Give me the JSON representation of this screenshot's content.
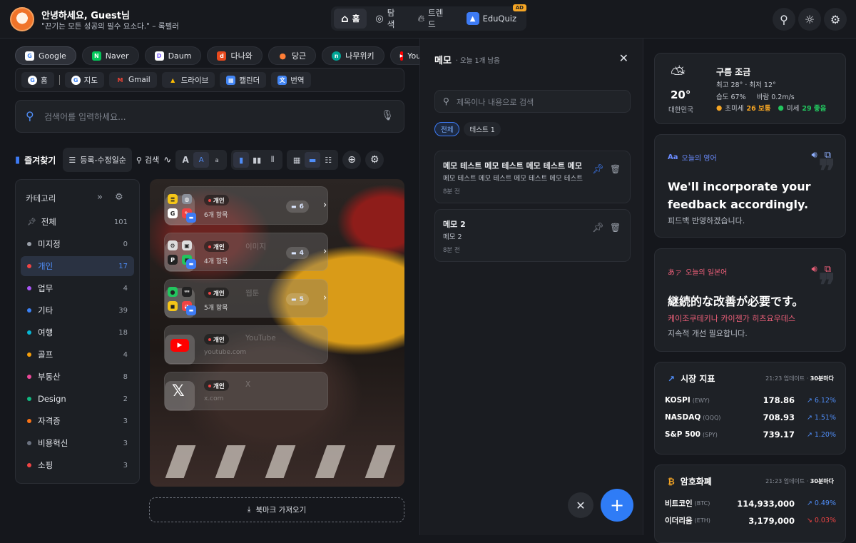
{
  "header": {
    "greeting": "안녕하세요, Guest님",
    "quote": "\"끈기는 모든 성공의 필수 요소다.\" – 록펠러",
    "nav": [
      {
        "label": "홈",
        "icon": "home-icon"
      },
      {
        "label": "탐색",
        "icon": "explore-icon"
      },
      {
        "label": "트렌드",
        "icon": "fire-icon"
      },
      {
        "label": "EduQuiz",
        "icon": "eduquiz-icon",
        "badge": "AD"
      }
    ]
  },
  "quick_links": [
    {
      "label": "Google",
      "color": "#ffffff",
      "glyph": "G"
    },
    {
      "label": "Naver",
      "color": "#03c75a",
      "glyph": "N"
    },
    {
      "label": "Daum",
      "color": "#7b61ff",
      "glyph": "D"
    },
    {
      "label": "다나와",
      "color": "#e8491d",
      "glyph": "d"
    },
    {
      "label": "당근",
      "color": "#ff7e36",
      "glyph": "●"
    },
    {
      "label": "나무위키",
      "color": "#00a495",
      "glyph": "n"
    },
    {
      "label": "YouTube",
      "color": "#ff0000",
      "glyph": "▶"
    }
  ],
  "google_links": [
    {
      "label": "홈",
      "color": "#ffffff",
      "glyph": "G"
    },
    {
      "label": "지도",
      "color": "#ffffff",
      "glyph": "G"
    },
    {
      "label": "Gmail",
      "color": "#ea4335",
      "glyph": "M"
    },
    {
      "label": "드라이브",
      "color": "#fbbc04",
      "glyph": "▲"
    },
    {
      "label": "캘린더",
      "color": "#4285f4",
      "glyph": "▦"
    },
    {
      "label": "번역",
      "color": "#4285f4",
      "glyph": "文"
    }
  ],
  "search": {
    "placeholder": "검색어를 입력하세요..."
  },
  "toolbar": {
    "favorites_label": "즐겨찾기",
    "sort_label": "등록-수정일순",
    "search_label": "검색",
    "font_sizes": [
      "A",
      "A",
      "a"
    ]
  },
  "categories": {
    "title": "카테고리",
    "items": [
      {
        "label": "전체",
        "count": "101",
        "color": "#9aa0aa",
        "pin": true
      },
      {
        "label": "미지정",
        "count": "0",
        "color": "#9aa0aa"
      },
      {
        "label": "개인",
        "count": "17",
        "color": "#ef4444",
        "selected": true
      },
      {
        "label": "업무",
        "count": "4",
        "color": "#a855f7"
      },
      {
        "label": "기타",
        "count": "39",
        "color": "#3b82f6"
      },
      {
        "label": "여행",
        "count": "18",
        "color": "#06b6d4"
      },
      {
        "label": "골프",
        "count": "4",
        "color": "#f59e0b"
      },
      {
        "label": "부동산",
        "count": "8",
        "color": "#ec4899"
      },
      {
        "label": "Design",
        "count": "2",
        "color": "#10b981"
      },
      {
        "label": "자격증",
        "count": "3",
        "color": "#f97316"
      },
      {
        "label": "비용혁신",
        "count": "3",
        "color": "#6b7280"
      },
      {
        "label": "소핑",
        "count": "3",
        "color": "#ef4444"
      }
    ]
  },
  "bookmarks": [
    {
      "tag": "개인",
      "name": "",
      "sub": "6개 항목",
      "folder": "6",
      "kind": "group"
    },
    {
      "tag": "개인",
      "name": "이미지",
      "sub": "4개 항목",
      "folder": "4",
      "kind": "group"
    },
    {
      "tag": "개인",
      "name": "웹툰",
      "sub": "5개 항목",
      "folder": "5",
      "kind": "group"
    },
    {
      "tag": "개인",
      "name": "YouTube",
      "sub": "youtube.com",
      "kind": "site",
      "icon": "youtube-icon"
    },
    {
      "tag": "개인",
      "name": "X",
      "sub": "x.com",
      "kind": "site",
      "icon": "x-logo-icon"
    }
  ],
  "import_label": "북마크 가져오기",
  "memo": {
    "title": "메모",
    "subtitle": "· 오늘 1개 남음",
    "search_placeholder": "제목이나 내용으로 검색",
    "tabs": [
      {
        "label": "전체",
        "active": true
      },
      {
        "label": "테스트 1",
        "active": false
      }
    ],
    "items": [
      {
        "title": "메모 테스트 메모 테스트 메모 테스트 메모 ...",
        "body": "메모 테스트 메모 테스트 메모 테스트 메모 테스트 ...",
        "time": "8분 전",
        "pinned": true
      },
      {
        "title": "메모 2",
        "body": "메모 2",
        "time": "8분 전",
        "pinned": false
      }
    ]
  },
  "weather": {
    "temp": "20°",
    "location": "대한민국",
    "desc": "구름 조금",
    "minmax": "최고 28° · 최저 12°",
    "humidity_wind": "습도 67%     바람 0.2m/s",
    "pm_ultra_label": "초미세",
    "pm_ultra_value": "26 보통",
    "pm_label": "미세",
    "pm_value": "29 좋음"
  },
  "english": {
    "tag": "오늘의 영어",
    "tag_glyph": "Aa",
    "sentence": "We'll incorporate your feedback accordingly.",
    "translation": "피드백 반영하겠습니다."
  },
  "japanese": {
    "tag": "오늘의 일본어",
    "tag_glyph": "あァ",
    "sentence": "継続的な改善が必要です。",
    "reading": "케이조쿠테키나 카이젠가 히츠요우데스",
    "translation": "지속적 개선 필요합니다."
  },
  "market": {
    "title": "시장 지표",
    "updated": "21:23 업데이트 ·",
    "interval": "30분마다",
    "rows": [
      {
        "name": "KOSPI",
        "ticker": "(EWY)",
        "value": "178.86",
        "change": "6.12%",
        "up": true
      },
      {
        "name": "NASDAQ",
        "ticker": "(QQQ)",
        "value": "708.93",
        "change": "1.51%",
        "up": true
      },
      {
        "name": "S&P 500",
        "ticker": "(SPY)",
        "value": "739.17",
        "change": "1.20%",
        "up": true
      }
    ]
  },
  "crypto": {
    "title": "암호화폐",
    "updated": "21:23 업데이트 ·",
    "interval": "30분마다",
    "rows": [
      {
        "name": "비트코인",
        "ticker": "(BTC)",
        "value": "114,933,000",
        "change": "0.49%",
        "up": true
      },
      {
        "name": "이더리움",
        "ticker": "(ETH)",
        "value": "3,179,000",
        "change": "0.03%",
        "up": false
      }
    ]
  },
  "colors": {
    "accent": "#3d7bf5",
    "up": "#4f8df7",
    "down": "#ef4444",
    "warn": "#f5a524",
    "good": "#22c55e"
  }
}
